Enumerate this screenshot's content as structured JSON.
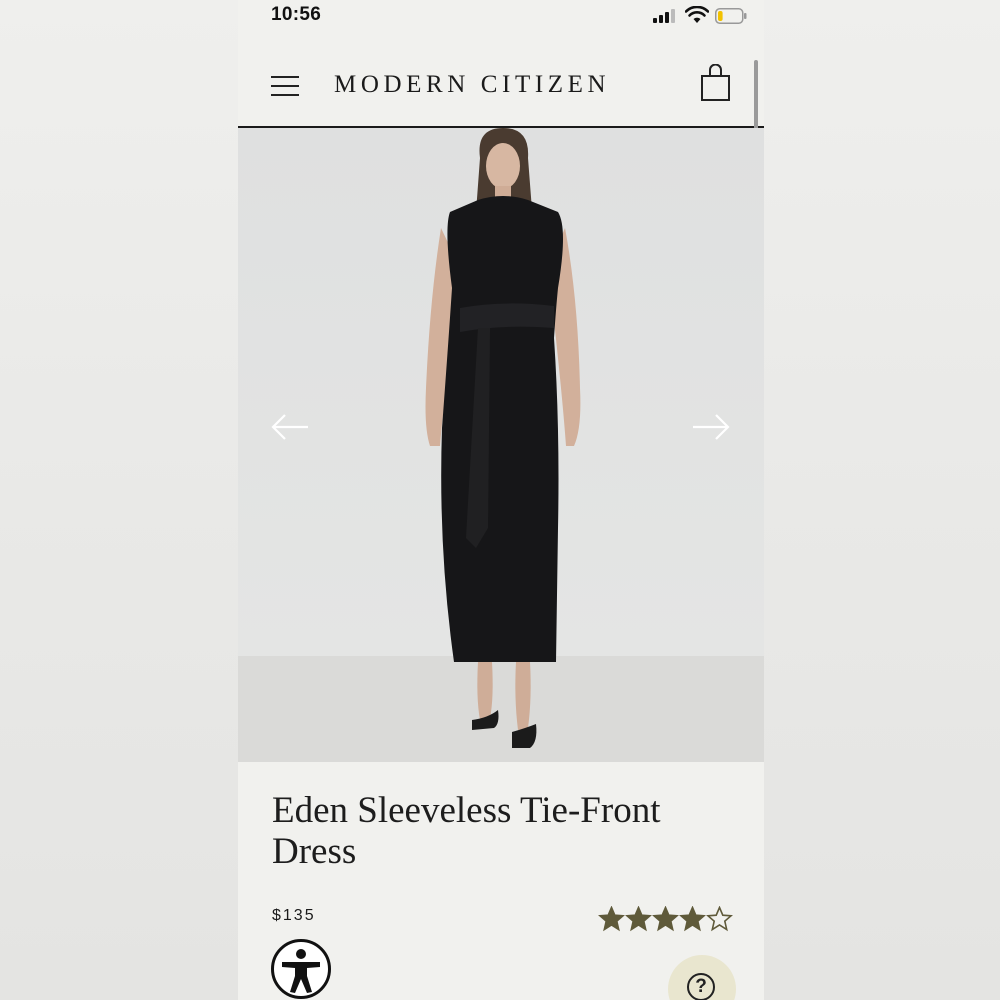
{
  "status_bar": {
    "time": "10:56",
    "signal_icon": "cellular-signal-icon",
    "wifi_icon": "wifi-icon",
    "battery_icon": "battery-low-icon",
    "battery_level": 0.2
  },
  "header": {
    "menu_icon": "hamburger-menu-icon",
    "brand": "MODERN CITIZEN",
    "bag_icon": "shopping-bag-icon"
  },
  "gallery": {
    "prev_icon": "arrow-left-icon",
    "next_icon": "arrow-right-icon"
  },
  "product": {
    "title": "Eden Sleeveless Tie-Front Dress",
    "price": "$135",
    "rating": 4,
    "rating_max": 5
  },
  "floating": {
    "accessibility_icon": "accessibility-icon",
    "help_label": "?"
  },
  "colors": {
    "star": "#5f5a3a",
    "help_bg": "#e9e6cf",
    "page_bg": "#f1f1ee"
  }
}
